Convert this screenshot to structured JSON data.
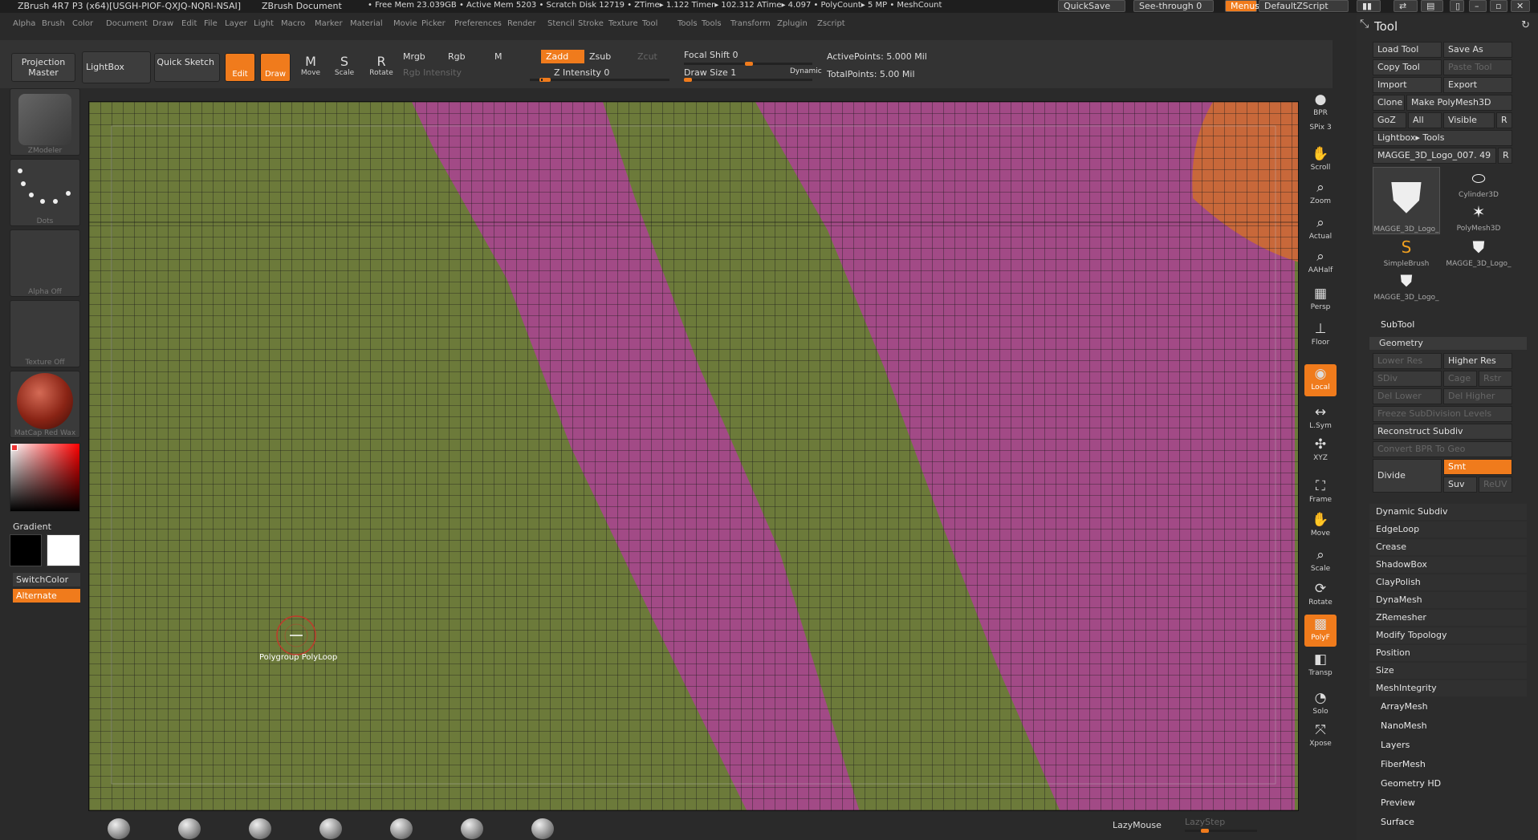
{
  "titlebar": {
    "app": "ZBrush 4R7 P3 (x64)[USGH-PIOF-QXJQ-NQRI-NSAI]",
    "document": "ZBrush Document",
    "stats": "• Free Mem 23.039GB • Active Mem 5203 • Scratch Disk 12719 • ZTime▸ 1.122 Timer▸ 102.312 ATime▸ 4.097 • PolyCount▸ 5 MP • MeshCount",
    "quicksave": "QuickSave",
    "see_through": "See-through  0",
    "menus": "Menus",
    "default_script": "DefaultZScript"
  },
  "menubar": [
    "Alpha",
    "Brush",
    "Color",
    "Document",
    "Draw",
    "Edit",
    "File",
    "Layer",
    "Light",
    "Macro",
    "Marker",
    "Material",
    "Movie",
    "Picker",
    "Preferences",
    "Render",
    "Stencil",
    "Stroke",
    "Texture",
    "Tool",
    "Tools",
    "Tools",
    "Transform",
    "Zplugin",
    "Zscript"
  ],
  "toolbar": {
    "projection_master": "Projection Master",
    "lightbox": "LightBox",
    "quick_sketch": "Quick Sketch",
    "edit": "Edit",
    "draw": "Draw",
    "move": "Move",
    "scale": "Scale",
    "rotate": "Rotate",
    "mrgb": "Mrgb",
    "rgb": "Rgb",
    "m": "M",
    "rgb_intensity": "Rgb Intensity",
    "zadd": "Zadd",
    "zsub": "Zsub",
    "zcut": "Zcut",
    "z_intensity": "Z Intensity 0",
    "focal_shift": "Focal Shift 0",
    "draw_size": "Draw Size 1",
    "dynamic": "Dynamic",
    "active_points": "ActivePoints: 5.000 Mil",
    "total_points": "TotalPoints: 5.00 Mil"
  },
  "leftshelf": {
    "zmodeler": "ZModeler",
    "dots": "Dots",
    "alpha": "Alpha Off",
    "texture": "Texture Off",
    "material": "MatCap Red Wax",
    "gradient": "Gradient",
    "switchcolor": "SwitchColor",
    "alternate": "Alternate"
  },
  "viewport": {
    "cursor_label": "Polygroup PolyLoop",
    "colors": {
      "green": "#6c7a3a",
      "magenta": "#a24a86",
      "orange": "#c8683a"
    }
  },
  "rightshelf": [
    {
      "name": "bpr",
      "label": "BPR",
      "icon": "bpr-icon"
    },
    {
      "name": "spix",
      "label": "SPix 3",
      "icon": "spix-icon"
    },
    {
      "name": "scroll",
      "label": "Scroll",
      "icon": "hand-icon"
    },
    {
      "name": "zoom",
      "label": "Zoom",
      "icon": "magnifier-icon"
    },
    {
      "name": "actual",
      "label": "Actual",
      "icon": "magnifier-icon"
    },
    {
      "name": "aahalf",
      "label": "AAHalf",
      "icon": "magnifier-icon"
    },
    {
      "name": "persp",
      "label": "Persp",
      "icon": "grid-icon"
    },
    {
      "name": "floor",
      "label": "Floor",
      "icon": "floor-icon"
    },
    {
      "name": "local",
      "label": "Local",
      "icon": "local-icon"
    },
    {
      "name": "lsym",
      "label": "L.Sym",
      "icon": "symmetry-icon"
    },
    {
      "name": "xyz",
      "label": "XYZ",
      "icon": "xyz-icon"
    },
    {
      "name": "frame",
      "label": "Frame",
      "icon": "frame-icon"
    },
    {
      "name": "move",
      "label": "Move",
      "icon": "hand-icon"
    },
    {
      "name": "scale",
      "label": "Scale",
      "icon": "magnifier-icon"
    },
    {
      "name": "rotate",
      "label": "Rotate",
      "icon": "rotate-icon"
    },
    {
      "name": "polyf",
      "label": "PolyF",
      "icon": "polyframe-icon"
    },
    {
      "name": "transp",
      "label": "Transp",
      "icon": "transparency-icon"
    },
    {
      "name": "solo",
      "label": "Solo",
      "icon": "solo-icon"
    },
    {
      "name": "xpose",
      "label": "Xpose",
      "icon": "xpose-icon"
    }
  ],
  "toolpanel": {
    "title": "Tool",
    "load_tool": "Load Tool",
    "save_as": "Save As",
    "copy_tool": "Copy Tool",
    "paste_tool": "Paste Tool",
    "import": "Import",
    "export": "Export",
    "clone": "Clone",
    "make_polymesh": "Make PolyMesh3D",
    "goz": "GoZ",
    "all": "All",
    "visible": "Visible",
    "r": "R",
    "lightbox_tools": "Lightbox▸ Tools",
    "current_tool": "MAGGE_3D_Logo_007. 49",
    "thumbs": [
      {
        "label": "MAGGE_3D_Logo_",
        "icon": "shield-icon"
      },
      {
        "label": "Cylinder3D",
        "icon": "cylinder-icon"
      },
      {
        "label": "PolyMesh3D",
        "icon": "star-icon"
      },
      {
        "label": "SimpleBrush",
        "icon": "brush-icon"
      },
      {
        "label": "MAGGE_3D_Logo_",
        "icon": "shield-icon"
      },
      {
        "label": "MAGGE_3D_Logo_",
        "icon": "shield-icon"
      }
    ],
    "subtool": "SubTool",
    "geometry": "Geometry",
    "lower_res": "Lower Res",
    "higher_res": "Higher Res",
    "sdiv": "SDiv",
    "cage": "Cage",
    "rstr": "Rstr",
    "del_lower": "Del Lower",
    "del_higher": "Del Higher",
    "freeze": "Freeze SubDivision Levels",
    "reconstruct": "Reconstruct Subdiv",
    "convert_bpr": "Convert BPR To Geo",
    "divide": "Divide",
    "smt": "Smt",
    "suv": "Suv",
    "reuv": "ReUV",
    "geometry_items": [
      "Dynamic Subdiv",
      "EdgeLoop",
      "Crease",
      "ShadowBox",
      "ClayPolish",
      "DynaMesh",
      "ZRemesher",
      "Modify Topology",
      "Position",
      "Size",
      "MeshIntegrity"
    ],
    "sections": [
      "ArrayMesh",
      "NanoMesh",
      "Layers",
      "FiberMesh",
      "Geometry HD",
      "Preview",
      "Surface"
    ]
  },
  "bottombar": {
    "lazymouse": "LazyMouse",
    "lazystep": "LazyStep"
  }
}
